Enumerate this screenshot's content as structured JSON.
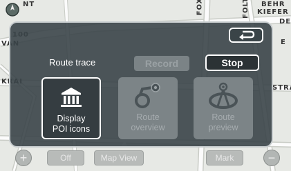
{
  "map": {
    "labels": [
      "NT",
      "100",
      "VAN",
      "KRAI",
      "FOX",
      "FOLTE",
      "BEHR",
      "KIEFER",
      "STRA",
      "DER",
      "E"
    ]
  },
  "dialog": {
    "route_trace_label": "Route trace",
    "record_label": "Record",
    "stop_label": "Stop",
    "buttons": [
      {
        "line1": "Display",
        "line2": "POI icons",
        "icon": "building-icon",
        "enabled": true
      },
      {
        "line1": "Route",
        "line2": "overview",
        "icon": "route-overview-icon",
        "enabled": false
      },
      {
        "line1": "Route",
        "line2": "preview",
        "icon": "route-preview-icon",
        "enabled": false
      }
    ],
    "back_icon": "return-arrow-icon"
  },
  "bottom_bar": {
    "off_label": "Off",
    "map_view_label": "Map View",
    "mark_label": "Mark",
    "zoom_in_icon": "plus-icon",
    "zoom_out_icon": "minus-icon"
  },
  "colors": {
    "panel": "#3a4448",
    "disabled": "#7c8487",
    "map": "#e7e9e5"
  }
}
